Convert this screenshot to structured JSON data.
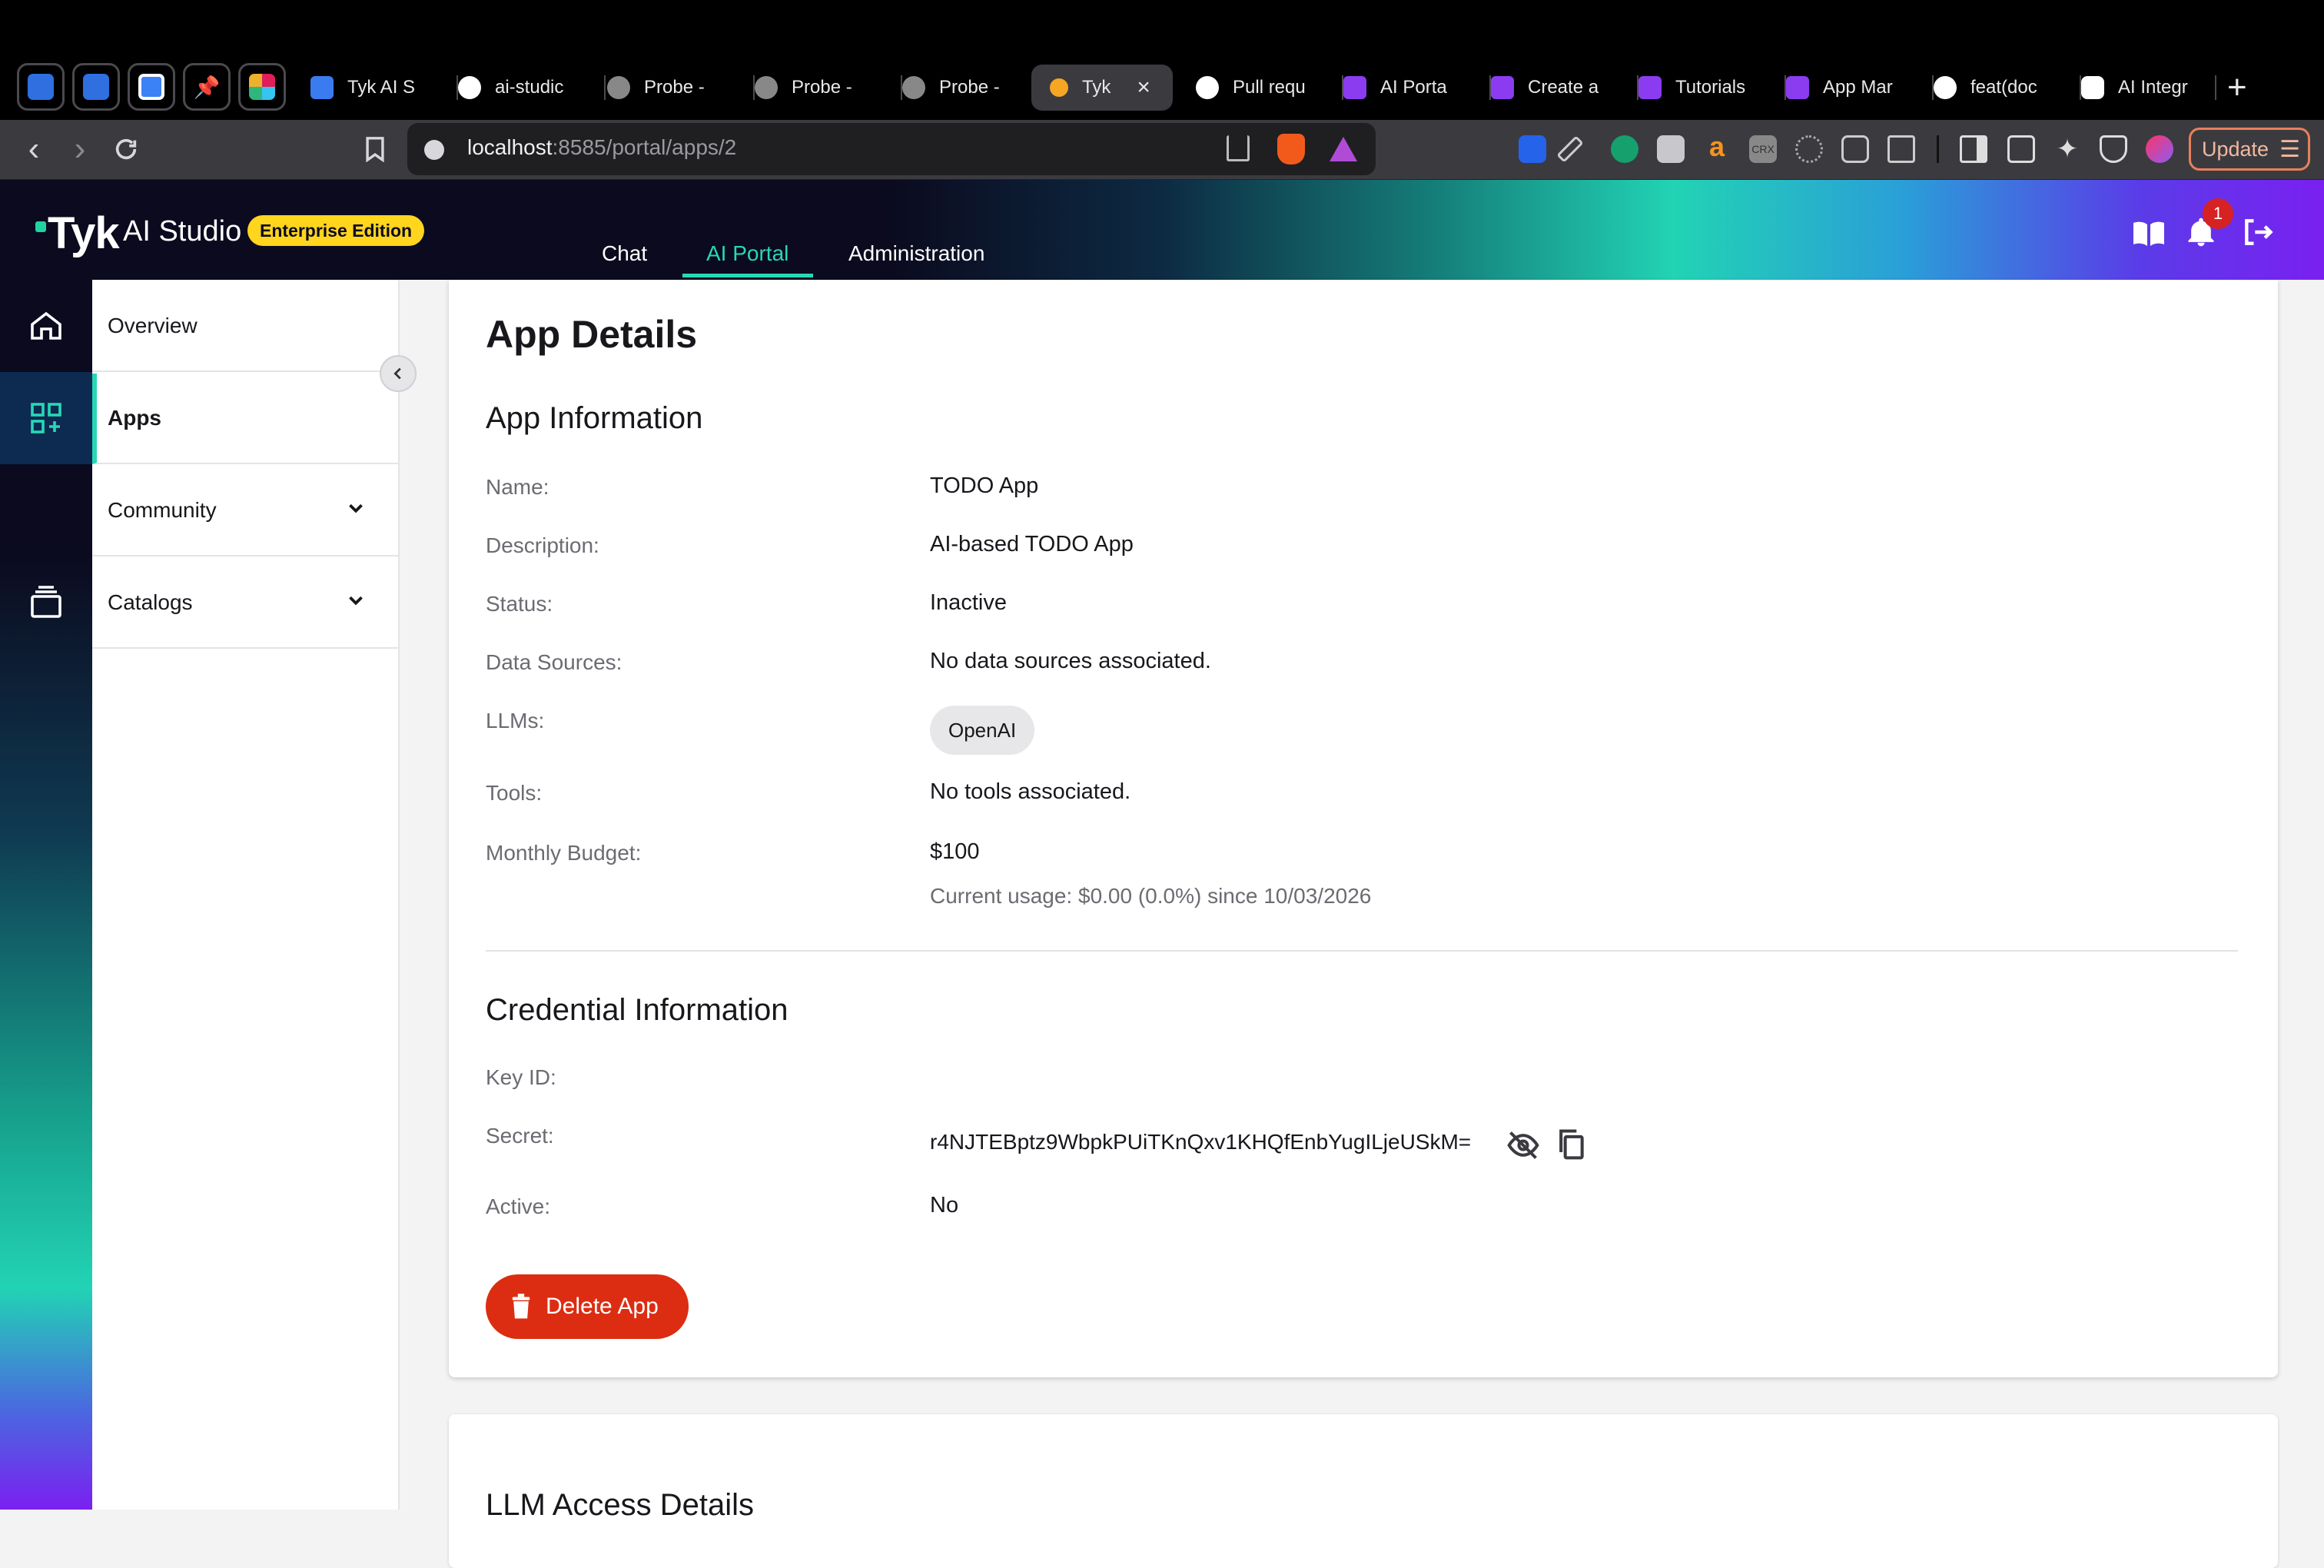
{
  "browser": {
    "tabs": [
      {
        "label": "Tyk AI S",
        "icon": "docs-icon"
      },
      {
        "label": "ai-studic",
        "icon": "github-icon"
      },
      {
        "label": "Probe -",
        "icon": "globe-icon"
      },
      {
        "label": "Probe -",
        "icon": "globe-icon"
      },
      {
        "label": "Probe -",
        "icon": "globe-icon"
      },
      {
        "label": "Tyk",
        "icon": "tyk-favicon",
        "active": true
      },
      {
        "label": "Pull requ",
        "icon": "github-icon"
      },
      {
        "label": "AI Porta",
        "icon": "purple-tab-icon"
      },
      {
        "label": "Create a",
        "icon": "purple-tab-icon"
      },
      {
        "label": "Tutorials",
        "icon": "purple-tab-icon"
      },
      {
        "label": "App Mar",
        "icon": "purple-tab-icon"
      },
      {
        "label": "feat(doc",
        "icon": "github-icon"
      },
      {
        "label": "AI Integr",
        "icon": "openai-icon"
      }
    ],
    "url_host": "localhost",
    "url_path": ":8585/portal/apps/2",
    "update_label": "Update",
    "accent": "#e8805c"
  },
  "header": {
    "logo": "Tyk",
    "product": "AI Studio",
    "edition": "Enterprise Edition",
    "nav": [
      "Chat",
      "AI Portal",
      "Administration"
    ],
    "active_nav": "AI Portal",
    "notification_count": "1",
    "accent": "#27d8b6",
    "badge_color": "#ffd51e"
  },
  "sidebar": {
    "items": [
      {
        "label": "Overview"
      },
      {
        "label": "Apps",
        "active": true
      },
      {
        "label": "Community",
        "expandable": true
      },
      {
        "label": "Catalogs",
        "expandable": true
      }
    ]
  },
  "main": {
    "title": "App Details",
    "app_info": {
      "heading": "App Information",
      "name_label": "Name:",
      "name": "TODO App",
      "description_label": "Description:",
      "description": "AI-based TODO App",
      "status_label": "Status:",
      "status": "Inactive",
      "data_sources_label": "Data Sources:",
      "data_sources": "No data sources associated.",
      "llms_label": "LLMs:",
      "llms": [
        "OpenAI"
      ],
      "tools_label": "Tools:",
      "tools": "No tools associated.",
      "budget_label": "Monthly Budget:",
      "budget": "$100",
      "usage": "Current usage: $0.00 (0.0%) since 10/03/2026"
    },
    "credential_info": {
      "heading": "Credential Information",
      "key_id_label": "Key ID:",
      "key_id": "",
      "secret_label": "Secret:",
      "secret": "r4NJTEBptz9WbpkPUiTKnQxv1KHQfEnbYugILjeUSkM=",
      "active_label": "Active:",
      "active": "No"
    },
    "delete_label": "Delete App",
    "delete_color": "#dc2d12",
    "next_section_title": "LLM Access Details"
  }
}
